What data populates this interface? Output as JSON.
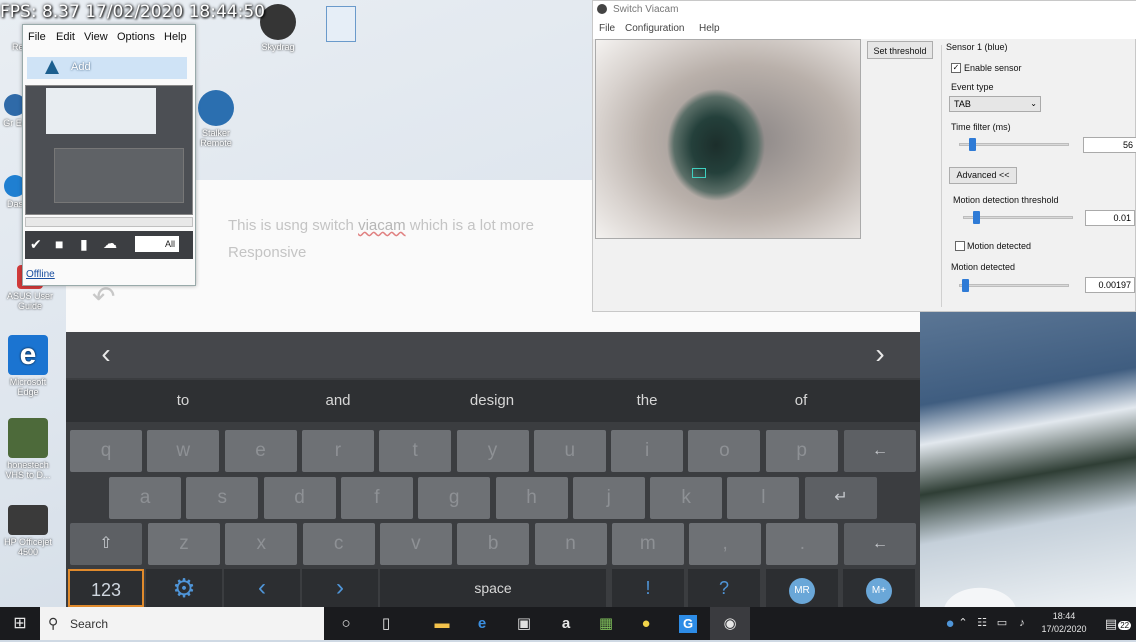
{
  "overlay": {
    "fps": "FPS: 8.37 17/02/2020 18:44:50"
  },
  "desktop_icons": [
    {
      "label": "Recycle",
      "color": "#6fa3d8"
    },
    {
      "label": "Gr\nEd",
      "color": "#2f6aa8"
    },
    {
      "label": "Das",
      "color": "#1f7fd1"
    },
    {
      "label": "ASUS User Guide",
      "color": "#d23b3b"
    },
    {
      "label": "Microsoft Edge",
      "color": "#1b74d1"
    },
    {
      "label": "honestech VHS to D...",
      "color": "#4d6a3a"
    },
    {
      "label": "HP Officejet 4500",
      "color": "#3a3a3a"
    },
    {
      "label": "Stalker Remote",
      "color": "#2b6fb0"
    },
    {
      "label": "Skydrag",
      "color": "#353535"
    }
  ],
  "tool_window": {
    "menu": [
      "File",
      "Edit",
      "View",
      "Options",
      "Help"
    ],
    "add_label": "Add",
    "offline_label": "Offline",
    "zoom": "All"
  },
  "document": {
    "text_before": "This is us",
    "text_mid": "ng switch ",
    "text_misspelled": "viacam",
    "text_after": " which is a lot more",
    "line2": "Responsive"
  },
  "keyboard": {
    "suggestions": [
      "to",
      "and",
      "design",
      "the",
      "of"
    ],
    "row1": [
      "q",
      "w",
      "e",
      "r",
      "t",
      "y",
      "u",
      "i",
      "o",
      "p"
    ],
    "row2": [
      "a",
      "s",
      "d",
      "f",
      "g",
      "h",
      "j",
      "k",
      "l"
    ],
    "row3": [
      "z",
      "x",
      "c",
      "v",
      "b",
      "n",
      "m",
      ",",
      "."
    ],
    "numbers_key": "123",
    "space_label": "space",
    "exclaim": "!",
    "question": "?",
    "mr": "MR",
    "mplus": "M+"
  },
  "viacam": {
    "title": "Switch Viacam",
    "menu": [
      "File",
      "Configuration",
      "Help"
    ],
    "set_threshold": "Set threshold",
    "sensor_group": "Sensor 1 (blue)",
    "enable_sensor": "Enable sensor",
    "event_type_label": "Event type",
    "event_type_value": "TAB",
    "time_filter_label": "Time filter (ms)",
    "time_filter_value": "56",
    "time_filter_level": 0.12,
    "advanced_button": "Advanced <<",
    "motion_threshold_label": "Motion detection threshold",
    "motion_threshold_value": "0.01",
    "motion_threshold_level": 0.12,
    "motion_detected_check": "Motion detected",
    "motion_detected_label": "Motion detected",
    "motion_detected_value": "0.00197",
    "motion_detected_level": 0.05
  },
  "taskbar": {
    "search_placeholder": "Search",
    "time": "18:44",
    "date": "17/02/2020",
    "notification_count": "22"
  }
}
